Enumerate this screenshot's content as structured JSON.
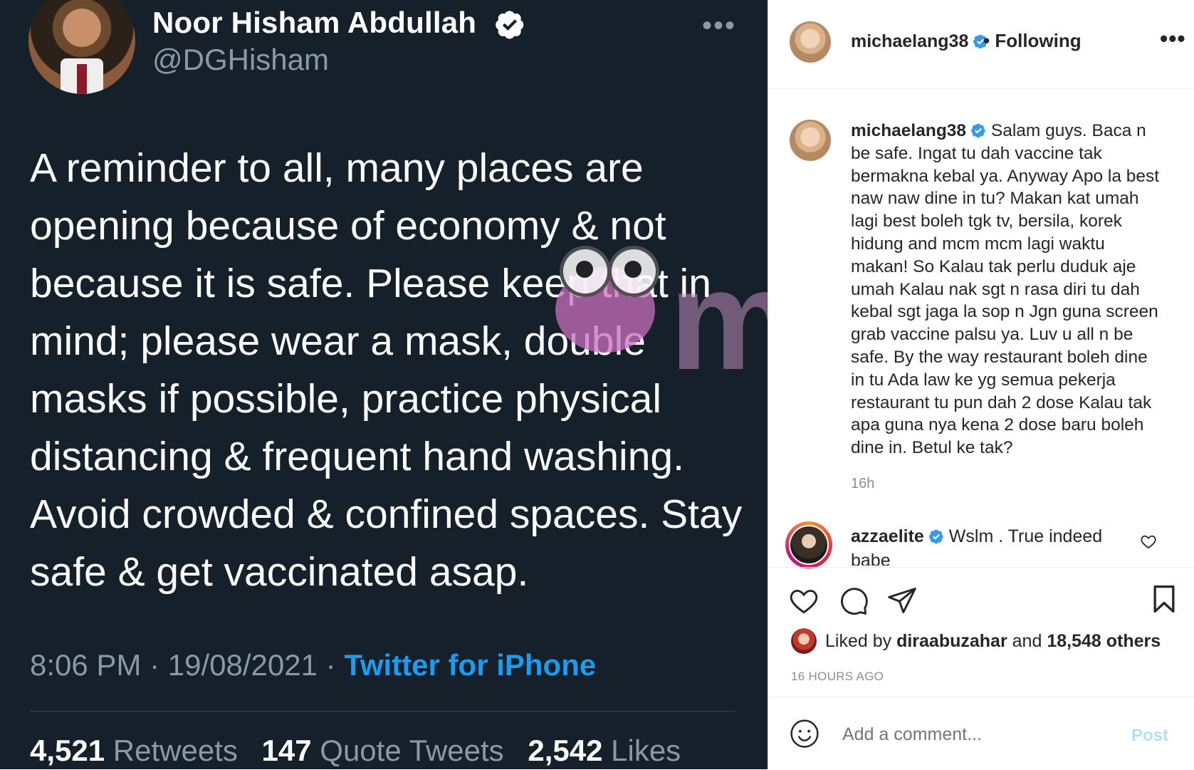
{
  "tweet": {
    "name": "Noor Hisham Abdullah",
    "handle": "@DGHisham",
    "more": "•••",
    "text": "A reminder to all, many places are opening because of economy & not because it is safe. Please keep that in mind; please wear a mask, double masks if possible, practice physical distancing & frequent hand washing. Avoid crowded & confined spaces. Stay safe & get vaccinated asap.",
    "time": "8:06 PM",
    "date": "19/08/2021",
    "separator": "·",
    "source": "Twitter for iPhone",
    "retweets_count": "4,521",
    "retweets_label": "Retweets",
    "quote_count": "147",
    "quote_label": "Quote Tweets",
    "likes_count": "2,542",
    "likes_label": "Likes",
    "colors": {
      "background": "#15202b",
      "link": "#1d9bf0",
      "muted": "#8b98a5"
    }
  },
  "watermark": {
    "text": "murai"
  },
  "instagram": {
    "username": "michaelang38",
    "following": "• Following",
    "more": "•••",
    "caption": "Salam guys. Baca n be safe. Ingat tu dah vaccine tak bermakna kebal ya. Anyway Apo la best naw naw dine in tu? Makan kat umah lagi best boleh tgk tv, bersila, korek hidung and mcm mcm lagi waktu makan! So Kalau tak perlu duduk aje umah Kalau nak sgt n rasa diri tu dah kebal sgt jaga la sop n Jgn guna screen grab vaccine palsu ya. Luv u all n be safe. By the way restaurant boleh dine in tu Ada law ke yg semua pekerja restaurant tu pun dah 2 dose Kalau tak apa guna nya kena 2 dose baru boleh dine in. Betul ke tak?",
    "caption_time": "16h",
    "comment_user": "azzaelite",
    "comment_text": "Wslm . True indeed babe",
    "liked_prefix": "Liked by",
    "liked_user": "diraabuzahar",
    "liked_and": "and",
    "liked_others": "18,548 others",
    "time_ago": "16 HOURS AGO",
    "comment_placeholder": "Add a comment...",
    "post_label": "Post",
    "colors": {
      "verified": "#3897f0",
      "muted": "#8e8e8e",
      "post_disabled": "#b2dffc"
    }
  }
}
